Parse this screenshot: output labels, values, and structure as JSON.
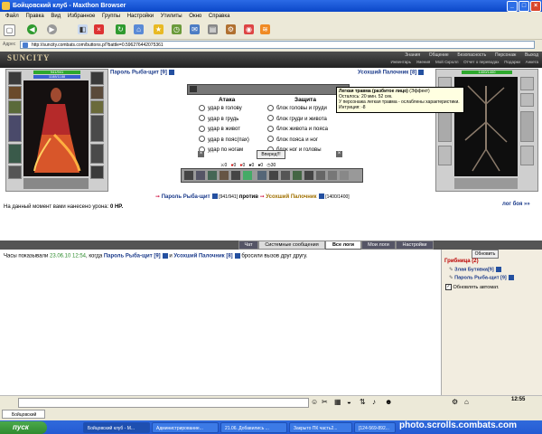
{
  "window": {
    "title": "Бойцовский клуб - Maxthon Browser"
  },
  "menu": [
    "Файл",
    "Правка",
    "Вид",
    "Избранное",
    "Группы",
    "Настройки",
    "Утилиты",
    "Окно",
    "Справка"
  ],
  "address": {
    "label": "Адрес",
    "url": "http://suncity.combats.com/buttons.pl?battle=0.596276442075361"
  },
  "game": {
    "logo": "SUNCITY",
    "nav_top": [
      "Знания",
      "Общение",
      "Безопасность",
      "Персонаж",
      "Выход"
    ],
    "nav_bottom": [
      "Инвентарь",
      "Умения",
      "Мой Скролл",
      "Отчет о переводах",
      "Подарки",
      "Анкета"
    ],
    "left_player": {
      "name": "Пароль Рыба-щит [9]",
      "hp": "941/941",
      "mp": "1188/1188",
      "hp_short": "941/941"
    },
    "right_player": {
      "name": "Усохший Палочник [8]",
      "hp": "1400/1400",
      "hp_short": "1400/1400"
    },
    "attack_title": "Атака",
    "defense_title": "Защита",
    "attacks": [
      "удар в голову",
      "удар в грудь",
      "удар в живот",
      "удар в пояс(пах)",
      "удар по ногам"
    ],
    "defenses": [
      "блок головы и груди",
      "блок груди и живота",
      "блок живота и пояса",
      "блок пояса и ног",
      "блок ног и головы"
    ],
    "go_button": "Вперед!!!",
    "counters": [
      "0",
      "0",
      "0",
      "0",
      "0",
      "30"
    ],
    "tooltip": {
      "title": "Легкая травма (разбитое лицо)",
      "tag": "(Эффект)",
      "line1": "Осталось: 20 мин. 52 сек.",
      "line2": "У персонажа легкая травма - ослаблены характеристики.",
      "line3": "Интуиция: -8"
    },
    "versus": {
      "left": "Пароль Рыба-щит",
      "left_hp": "[941/941]",
      "word": "против",
      "right": "Усохший Палочник",
      "right_hp": "[1400/1400]"
    },
    "battle_log_link": "лог боя »»",
    "damage_text": "На данный момент вами нанесено урона:",
    "damage_value": "0 HP.",
    "tabs": [
      "Чат",
      "Системные сообщения",
      "Все логи",
      "Мои логи",
      "Настройки"
    ],
    "chat_line": {
      "pre": "Часы показывали",
      "time": "23.06.10 12:54",
      "mid": ", когда",
      "p1": "Пароль Рыба-щит [9]",
      "and": "и",
      "p2": "Усохший Палочник [8]",
      "post": "бросили вызов друг другу."
    },
    "right_panel": {
      "refresh_button": "Обновить",
      "location": "Грибница (2)",
      "users": [
        "Злая Бутявка[9]",
        "Пароль Рыба-щит [9]"
      ],
      "auto_refresh": "Обновлять автомат."
    }
  },
  "statusbar": {
    "clock": "12:55"
  },
  "taskbar": {
    "start": "пуск",
    "tasks": [
      "Бойцовский клуб - M...",
      "Администрирование...",
      "21.06. Добавились ...",
      "Закрыто ПК часть2...",
      "[124-569-892..."
    ],
    "tray_text": "photo.scrolls.combats.com"
  }
}
